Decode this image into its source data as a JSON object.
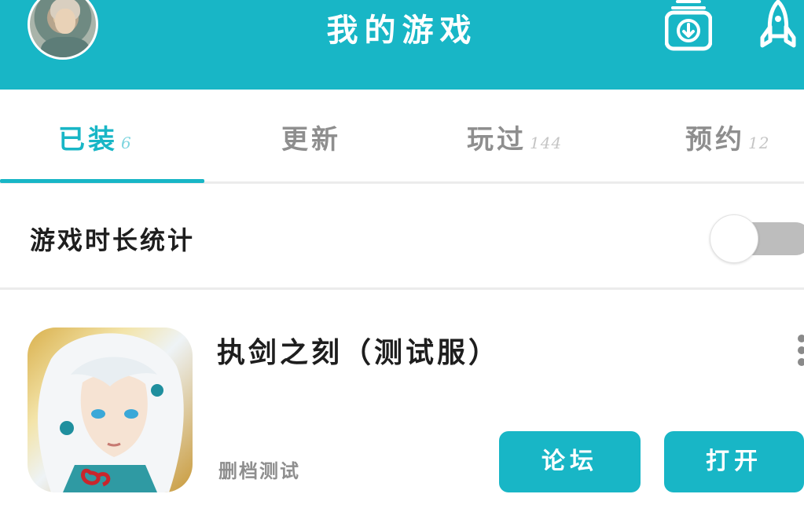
{
  "header": {
    "title": "我的游戏",
    "accent_color": "#18b6c6"
  },
  "icons": {
    "avatar": "user-avatar",
    "download": "download-icon",
    "rocket": "rocket-icon",
    "more": "more-vertical-icon"
  },
  "tabs": [
    {
      "label": "已装",
      "count": "6",
      "active": true
    },
    {
      "label": "更新",
      "count": "",
      "active": false
    },
    {
      "label": "玩过",
      "count": "144",
      "active": false
    },
    {
      "label": "预约",
      "count": "12",
      "active": false
    }
  ],
  "stat": {
    "label": "游戏时长统计",
    "toggle_on": false
  },
  "game": {
    "title": "执剑之刻（测试服）",
    "subtitle": "删档测试",
    "forum_label": "论坛",
    "open_label": "打开"
  }
}
